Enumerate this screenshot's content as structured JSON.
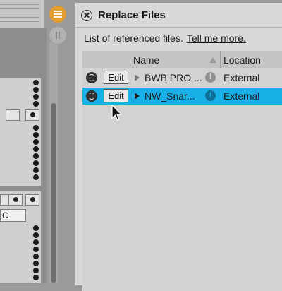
{
  "dialog": {
    "title": "Replace Files",
    "description": "List of referenced files.",
    "help_link": "Tell me more."
  },
  "table": {
    "columns": {
      "name": "Name",
      "location": "Location"
    },
    "rows": [
      {
        "edit_label": "Edit",
        "name": "BWB PRO ...",
        "location": "External",
        "selected": false
      },
      {
        "edit_label": "Edit",
        "name": "NW_Snar...",
        "location": "External",
        "selected": true
      }
    ]
  },
  "left_panel": {
    "field_value": "C"
  },
  "colors": {
    "selection": "#19b0e8",
    "accent": "#e29c2f"
  },
  "icons": [
    "hamburger-icon",
    "pause-icon",
    "close-icon",
    "sort-ascending-icon",
    "sync-icon",
    "expand-triangle-icon",
    "warning-icon",
    "mouse-cursor-icon"
  ]
}
